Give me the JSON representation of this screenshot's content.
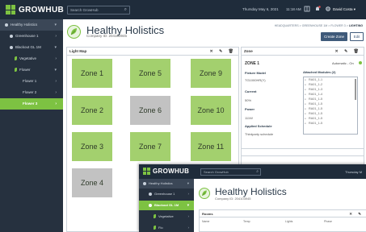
{
  "app": {
    "brand": "GROWHUB",
    "search_placeholder": "Search GrowHub",
    "date": "Thursday May 6, 2021",
    "time": "11:18 AM",
    "user": "David Costa ▾"
  },
  "sidebar": [
    {
      "label": "Healthy Holistics",
      "level": "top"
    },
    {
      "label": "Greenhouse 1",
      "level": "sub"
    },
    {
      "label": "Blackout GL 1M",
      "level": "sub"
    },
    {
      "label": "Vegetative",
      "level": "leaf"
    },
    {
      "label": "Flower",
      "level": "leaf"
    },
    {
      "label": "Flower 1",
      "level": "room"
    },
    {
      "label": "Flower 2",
      "level": "room"
    },
    {
      "label": "Flower 3",
      "level": "room",
      "active": true
    }
  ],
  "company": {
    "name": "Healthy Holistics",
    "id_label": "Company ID: 204103945"
  },
  "breadcrumb": {
    "path": "HEADQUARTERS > GREENHOUSE 1M > FLOWER 3 > ",
    "current": "LIGHTING"
  },
  "actions": {
    "create_zone": "Create Zone",
    "edit": "Edit"
  },
  "light_map": {
    "title": "Light Map",
    "tools": "✕ ✎ 🗑",
    "zones": [
      {
        "label": "Zone 1",
        "state": "on"
      },
      {
        "label": "Zone 5",
        "state": "on"
      },
      {
        "label": "Zone 9",
        "state": "on"
      },
      {
        "label": "Zone 2",
        "state": "on"
      },
      {
        "label": "Zone 6",
        "state": "off"
      },
      {
        "label": "Zone 10",
        "state": "on"
      },
      {
        "label": "Zone 3",
        "state": "on"
      },
      {
        "label": "Zone 7",
        "state": "on"
      },
      {
        "label": "Zone 11",
        "state": "on"
      },
      {
        "label": "Zone 4",
        "state": "off"
      }
    ]
  },
  "zone_panel": {
    "title": "Zone",
    "tools": "✕ ✎ 🗑",
    "zone_name": "ZONE 1",
    "mode": "Automatic - On",
    "fixture_model_label": "Fixture Model",
    "fixture_model": "TG1000HR(Y)",
    "current_label": "Current",
    "current": "50%",
    "power_label": "Power",
    "power": "111W",
    "schedule_label": "Applied Schedule",
    "schedule": "Thirdparty schedule",
    "attached_label": "Attached Modules (2)",
    "modules": [
      "RA01_1-1",
      "RA01_1-2",
      "RA01_1-3",
      "RA01_1-4",
      "RA01_1-5",
      "RA01_1-5",
      "RA01_1-5",
      "RA01_1-5",
      "RA01_1-5",
      "RA01_1-5"
    ]
  },
  "front": {
    "brand": "GROWHUB",
    "search_placeholder": "Search GrowHub",
    "date": "Thursday M",
    "sidebar": [
      {
        "label": "Healthy Holistics",
        "level": "top"
      },
      {
        "label": "Greenhouse 1",
        "level": "sub"
      },
      {
        "label": "Blackout GL 1M",
        "level": "sub",
        "active": true
      },
      {
        "label": "Vegetative",
        "level": "leaf"
      },
      {
        "label": "Flo",
        "level": "leaf"
      }
    ],
    "company_name": "Healthy Holistics",
    "company_id": "Company ID: 204103945",
    "rooms_title": "Rooms",
    "rooms_tools": "✕ ✎",
    "columns": [
      "Name",
      "Temp",
      "Lights",
      "Phase"
    ]
  },
  "colors": {
    "topbar": "#1f2c3b",
    "sidebar": "#26313f",
    "accent": "#7dc242",
    "zone_on": "#a3d06e",
    "zone_off": "#c2c2c2",
    "button": "#3f5a7a"
  }
}
